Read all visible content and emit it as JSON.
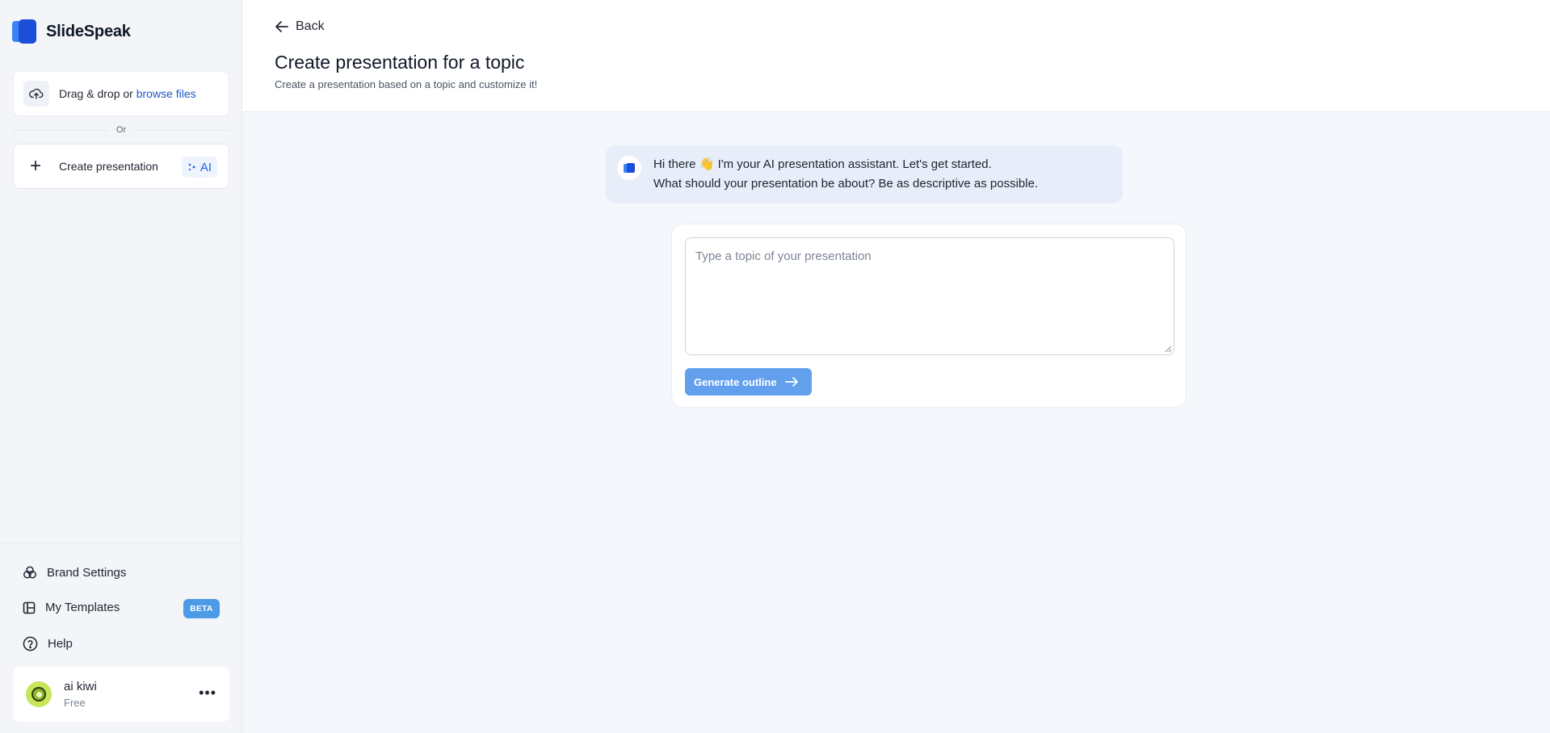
{
  "app": {
    "name": "SlideSpeak"
  },
  "sidebar": {
    "upload": {
      "prefix": "Drag & drop or ",
      "link": "browse files"
    },
    "or_label": "Or",
    "create": {
      "label": "Create presentation",
      "ai_badge": "AI"
    },
    "nav": [
      {
        "label": "Brand Settings",
        "icon": "brand-settings-icon"
      },
      {
        "label": "My Templates",
        "icon": "templates-icon",
        "badge": "BETA"
      },
      {
        "label": "Help",
        "icon": "help-icon"
      }
    ],
    "user": {
      "name": "ai kiwi",
      "plan": "Free"
    }
  },
  "header": {
    "back_label": "Back",
    "title": "Create presentation for a topic",
    "subtitle": "Create a presentation based on a topic and customize it!"
  },
  "assistant": {
    "line1_a": "Hi there",
    "wave": "👋",
    "line1_b": "I'm your AI presentation assistant. Let's get started.",
    "line2": "What should your presentation be about? Be as descriptive as possible."
  },
  "form": {
    "topic_placeholder": "Type a topic of your presentation",
    "topic_value": "",
    "generate_label": "Generate outline"
  },
  "colors": {
    "brand_blue": "#1d4ed8",
    "link_blue": "#1e56c8",
    "beta_badge": "#4d9be6",
    "generate_button": "#62a0ee",
    "bubble_bg": "#e7eef9"
  }
}
